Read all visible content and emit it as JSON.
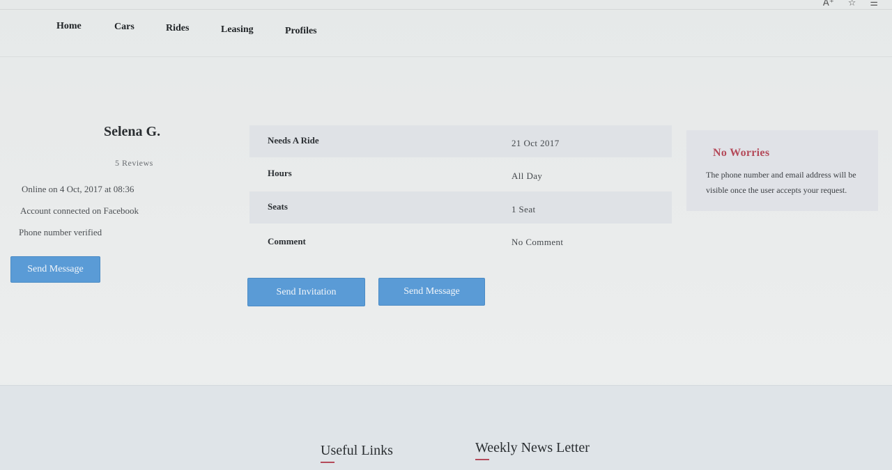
{
  "nav": {
    "items": [
      "Home",
      "Cars",
      "Rides",
      "Leasing",
      "Profiles"
    ]
  },
  "browser": {
    "icons": [
      "A⁺",
      "☆",
      "☰"
    ]
  },
  "profile": {
    "name": "Selena G.",
    "reviews": "5 Reviews",
    "online": "Online on 4 Oct, 2017 at 08:36",
    "facebook": "Account connected on Facebook",
    "phone": "Phone number verified",
    "send_message_label": "Send Message"
  },
  "details": {
    "rows": [
      {
        "label": "Needs A Ride",
        "value": "21 Oct 2017"
      },
      {
        "label": "Hours",
        "value": "All Day"
      },
      {
        "label": "Seats",
        "value": "1 Seat"
      },
      {
        "label": "Comment",
        "value": "No Comment"
      }
    ],
    "send_invitation_label": "Send Invitation",
    "send_message_label": "Send Message"
  },
  "notice": {
    "title": "No Worries",
    "text": "The phone number and email address will be visible once the user accepts your request."
  },
  "footer": {
    "useful_links": "Useful Links",
    "newsletter": "Weekly News Letter"
  },
  "colors": {
    "accent_button": "#5a9bd6",
    "notice_title": "#b44a5a"
  }
}
